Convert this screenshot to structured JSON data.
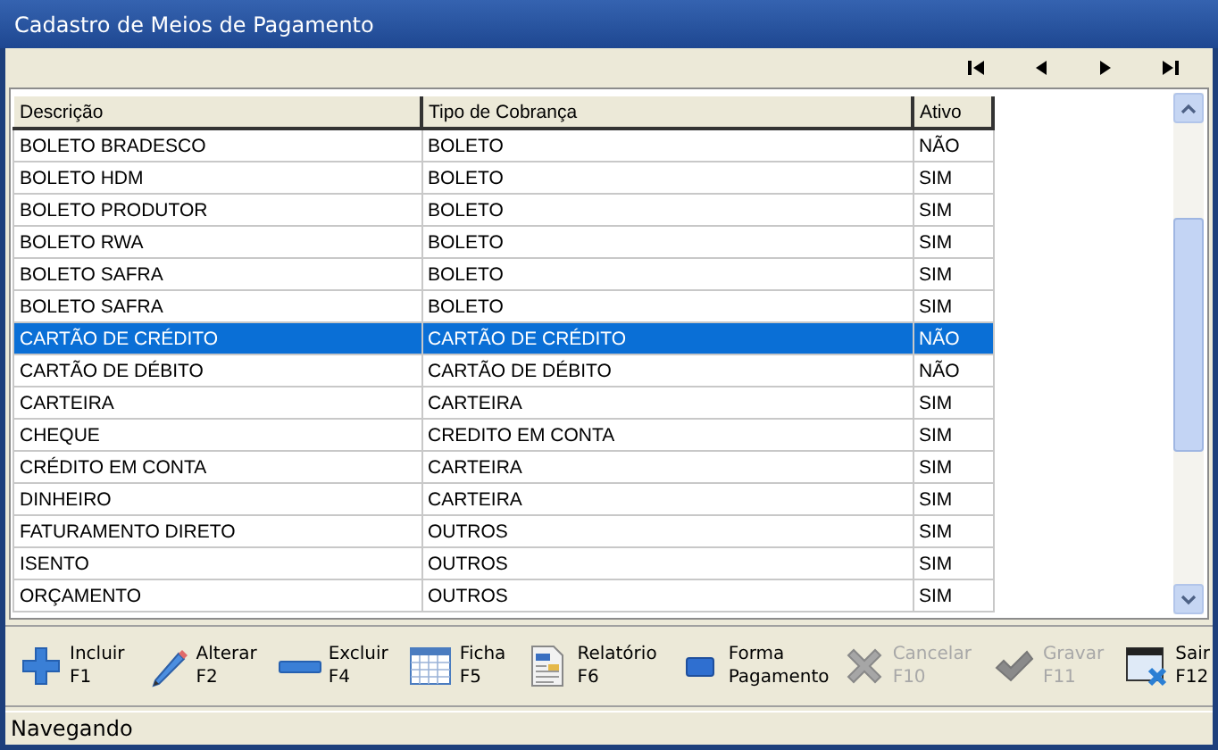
{
  "window": {
    "title": "Cadastro de Meios de Pagamento"
  },
  "navigator": [
    {
      "kind": "first"
    },
    {
      "kind": "prior"
    },
    {
      "kind": "next"
    },
    {
      "kind": "last"
    }
  ],
  "table": {
    "columns": [
      "Descrição",
      "Tipo de Cobrança",
      "Ativo"
    ],
    "rows": [
      {
        "cells": [
          "BOLETO BRADESCO",
          "BOLETO",
          "NÃO"
        ],
        "selected": false
      },
      {
        "cells": [
          "BOLETO HDM",
          "BOLETO",
          "SIM"
        ],
        "selected": false
      },
      {
        "cells": [
          "BOLETO PRODUTOR",
          "BOLETO",
          "SIM"
        ],
        "selected": false
      },
      {
        "cells": [
          "BOLETO RWA",
          "BOLETO",
          "SIM"
        ],
        "selected": false
      },
      {
        "cells": [
          "BOLETO SAFRA",
          "BOLETO",
          "SIM"
        ],
        "selected": false
      },
      {
        "cells": [
          "BOLETO SAFRA",
          "BOLETO",
          "SIM"
        ],
        "selected": false
      },
      {
        "cells": [
          "CARTÃO DE CRÉDITO",
          "CARTÃO DE CRÉDITO",
          "NÃO"
        ],
        "selected": true
      },
      {
        "cells": [
          "CARTÃO DE DÉBITO",
          "CARTÃO DE DÉBITO",
          "NÃO"
        ],
        "selected": false
      },
      {
        "cells": [
          "CARTEIRA",
          "CARTEIRA",
          "SIM"
        ],
        "selected": false
      },
      {
        "cells": [
          "CHEQUE",
          "CREDITO EM CONTA",
          "SIM"
        ],
        "selected": false
      },
      {
        "cells": [
          "CRÉDITO EM CONTA",
          "CARTEIRA",
          "SIM"
        ],
        "selected": false
      },
      {
        "cells": [
          "DINHEIRO",
          "CARTEIRA",
          "SIM"
        ],
        "selected": false
      },
      {
        "cells": [
          "FATURAMENTO DIRETO",
          "OUTROS",
          "SIM"
        ],
        "selected": false
      },
      {
        "cells": [
          "ISENTO",
          "OUTROS",
          "SIM"
        ],
        "selected": false
      },
      {
        "cells": [
          "ORÇAMENTO",
          "OUTROS",
          "SIM"
        ],
        "selected": false
      }
    ]
  },
  "toolbar": [
    {
      "kind": "plus",
      "label": "Incluir",
      "shortcut": "F1",
      "disabled": false
    },
    {
      "kind": "pencil",
      "label": "Alterar",
      "shortcut": "F2",
      "disabled": false
    },
    {
      "kind": "minus",
      "label": "Excluir",
      "shortcut": "F4",
      "disabled": false
    },
    {
      "kind": "grid",
      "label": "Ficha",
      "shortcut": "F5",
      "disabled": false
    },
    {
      "kind": "report",
      "label": "Relatório",
      "shortcut": "F6",
      "disabled": false
    },
    {
      "kind": "card",
      "label": "Forma Pagamento",
      "disabled": false
    },
    {
      "kind": "cross",
      "label": "Cancelar",
      "shortcut": "F10",
      "disabled": true
    },
    {
      "kind": "check",
      "label": "Gravar",
      "shortcut": "F11",
      "disabled": true
    },
    {
      "kind": "exit",
      "label": "Sair",
      "shortcut": "F12",
      "disabled": false
    }
  ],
  "status_bar": "Navegando"
}
